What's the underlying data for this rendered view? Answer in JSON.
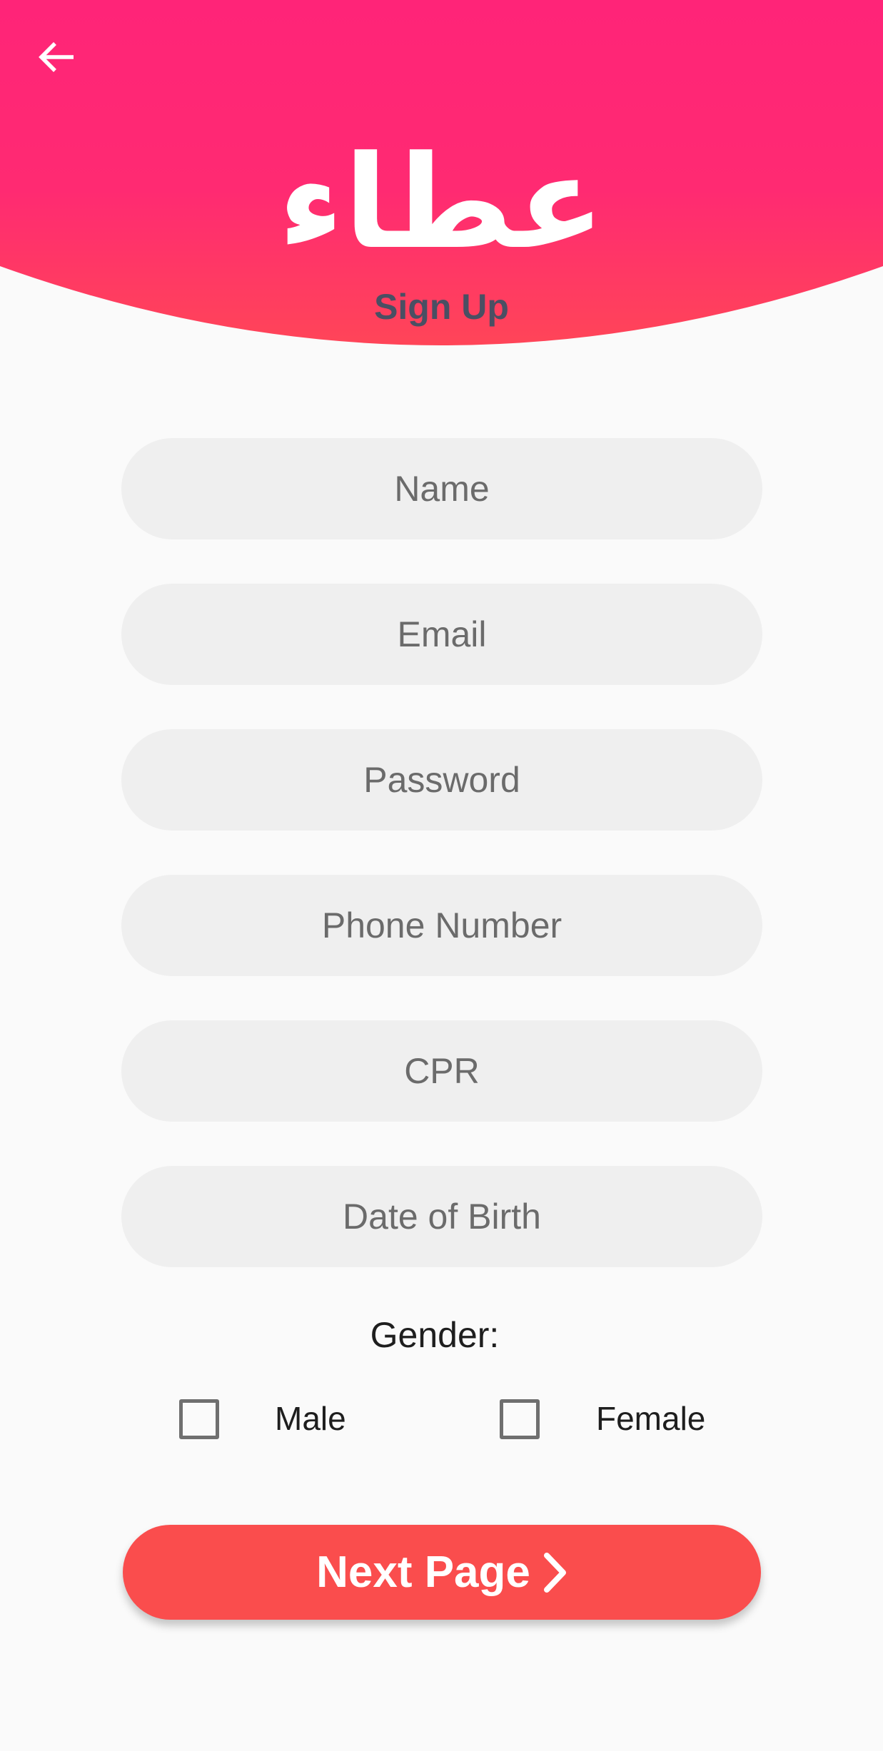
{
  "header": {
    "logo_text": "عطاء",
    "subtitle": "Sign Up",
    "back_icon": "arrow-left-icon",
    "gradient_top": "#ff2478",
    "gradient_bottom": "#ff4558"
  },
  "form": {
    "name_placeholder": "Name",
    "email_placeholder": "Email",
    "password_placeholder": "Password",
    "phone_placeholder": "Phone Number",
    "cpr_placeholder": "CPR",
    "dob_placeholder": "Date of Birth"
  },
  "gender": {
    "label": "Gender:",
    "male_label": "Male",
    "female_label": "Female",
    "male_checked": false,
    "female_checked": false
  },
  "next_button": {
    "label": "Next Page",
    "icon": "chevron-right-icon",
    "color": "#fa4d4d"
  }
}
